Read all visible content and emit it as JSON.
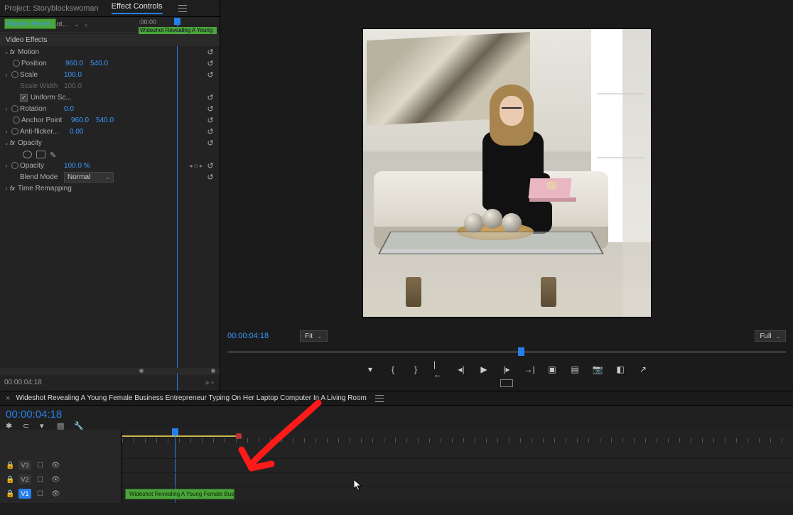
{
  "ec": {
    "tabs": {
      "project": "Project: Storyblockswoman",
      "effect_controls": "Effect Controls"
    },
    "breadcrumb": {
      "master": "Master * Wideshot...",
      "clip": "Wideshot Reveal..."
    },
    "mini": {
      "time_label": ":00:00",
      "clip_label": "Wideshot Revealing A Young"
    },
    "section_video_effects": "Video Effects",
    "motion": {
      "label": "Motion",
      "position": {
        "label": "Position",
        "x": "960.0",
        "y": "540.0"
      },
      "scale": {
        "label": "Scale",
        "v": "100.0"
      },
      "scale_width": {
        "label": "Scale Width",
        "v": "100.0"
      },
      "uniform": {
        "label": "Uniform Sc..."
      },
      "rotation": {
        "label": "Rotation",
        "v": "0.0"
      },
      "anchor": {
        "label": "Anchor Point",
        "x": "960.0",
        "y": "540.0"
      },
      "antiflicker": {
        "label": "Anti-flicker...",
        "v": "0.00"
      }
    },
    "opacity": {
      "label": "Opacity",
      "value_label": "Opacity",
      "value": "100.0 %",
      "blend_label": "Blend Mode",
      "blend_value": "Normal"
    },
    "time_remap": "Time Remapping",
    "footer_tc": "00:00:04:18"
  },
  "program": {
    "tc": "00:00:04:18",
    "fit_label": "Fit",
    "quality_label": "Full"
  },
  "timeline": {
    "tab_name": "Wideshot Revealing A Young Female Business Entrepreneur Typing On Her Laptop Computer In A Living Room",
    "tc": "00:00:04:18",
    "tracks": {
      "v3": "V3",
      "v2": "V2",
      "v1": "V1"
    },
    "clip_label": "Wideshot Revealing A Young Female Bus"
  }
}
